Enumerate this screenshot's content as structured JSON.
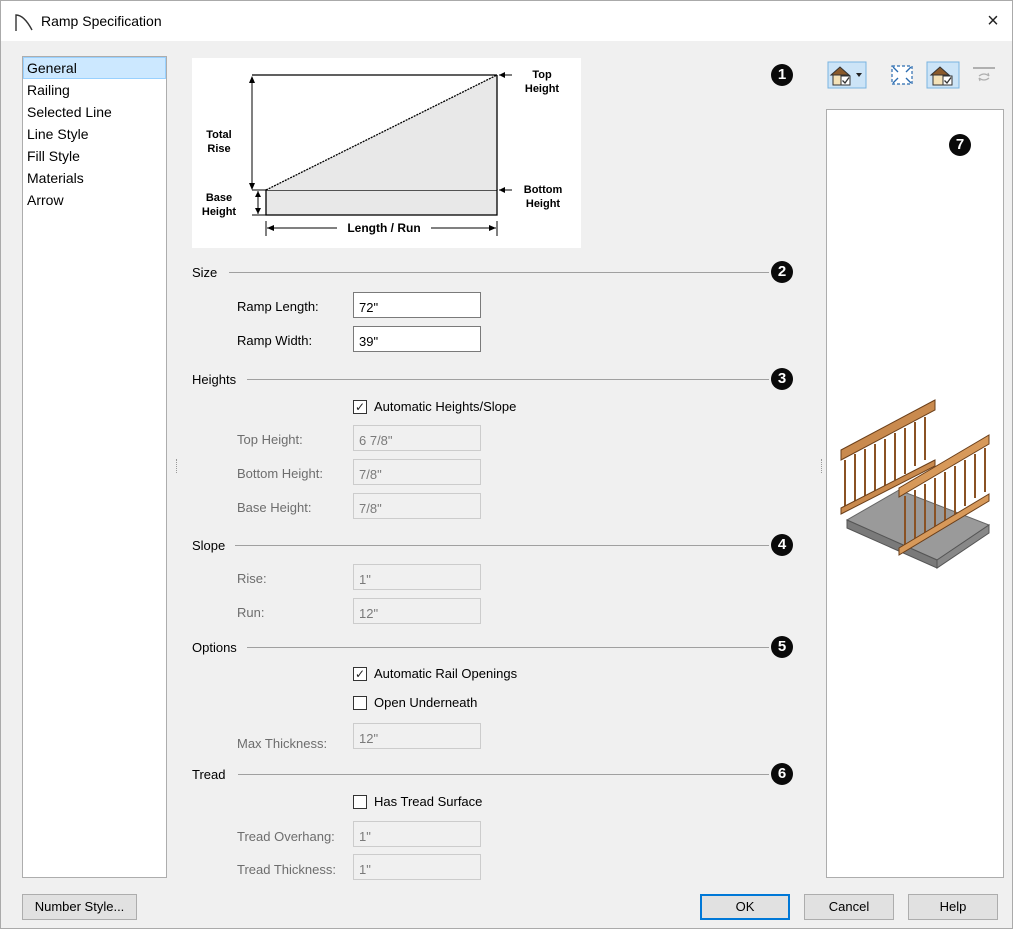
{
  "window": {
    "title": "Ramp Specification",
    "close": "×"
  },
  "nav": {
    "items": [
      {
        "label": "General"
      },
      {
        "label": "Railing"
      },
      {
        "label": "Selected Line"
      },
      {
        "label": "Line Style"
      },
      {
        "label": "Fill Style"
      },
      {
        "label": "Materials"
      },
      {
        "label": "Arrow"
      }
    ],
    "selected": "General"
  },
  "diagram": {
    "top_height": "Top\nHeight",
    "total_rise": "Total\nRise",
    "base_height": "Base\nHeight",
    "bottom_height": "Bottom\nHeight",
    "length_run": "Length / Run"
  },
  "badges": [
    "1",
    "2",
    "3",
    "4",
    "5",
    "6",
    "7"
  ],
  "size": {
    "title": "Size",
    "ramp_length_label": "Ramp Length:",
    "ramp_length": "72\"",
    "ramp_width_label": "Ramp Width:",
    "ramp_width": "39\""
  },
  "heights": {
    "title": "Heights",
    "auto_label": "Automatic Heights/Slope",
    "auto_checked": true,
    "top_height_label": "Top Height:",
    "top_height": "6 7/8\"",
    "bottom_height_label": "Bottom Height:",
    "bottom_height": "7/8\"",
    "base_height_label": "Base Height:",
    "base_height": "7/8\""
  },
  "slope": {
    "title": "Slope",
    "rise_label": "Rise:",
    "rise": "1\"",
    "run_label": "Run:",
    "run": "12\""
  },
  "options": {
    "title": "Options",
    "auto_rail_label": "Automatic Rail Openings",
    "auto_rail_checked": true,
    "open_under_label": "Open Underneath",
    "open_under_checked": false,
    "max_thickness_label": "Max Thickness:",
    "max_thickness": "12\""
  },
  "tread": {
    "title": "Tread",
    "has_tread_label": "Has Tread Surface",
    "has_tread_checked": false,
    "overhang_label": "Tread Overhang:",
    "overhang": "1\"",
    "thickness_label": "Tread Thickness:",
    "thickness": "1\""
  },
  "buttons": {
    "number_style": "Number Style...",
    "ok": "OK",
    "cancel": "Cancel",
    "help": "Help"
  },
  "check_glyph": "✓",
  "colors": {
    "accent": "#0078d7",
    "selected_bg": "#cce8ff",
    "badge": "#0a0a0a"
  }
}
